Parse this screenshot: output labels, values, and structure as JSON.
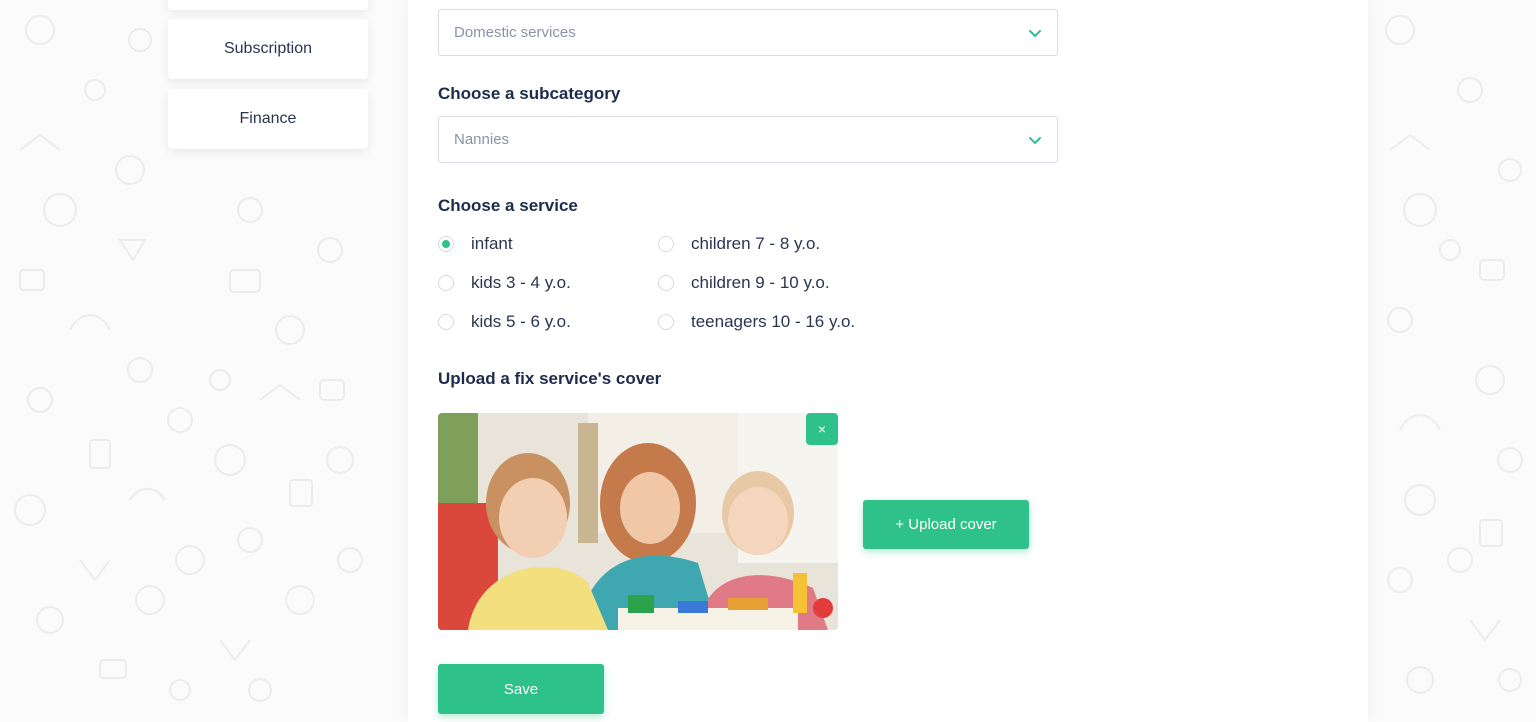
{
  "sidebar": {
    "items": [
      {
        "label": ""
      },
      {
        "label": "Subscription"
      },
      {
        "label": "Finance"
      }
    ]
  },
  "form": {
    "category": {
      "value": "Domestic services",
      "icon": "chevron-down-icon"
    },
    "subcategory": {
      "label": "Choose a subcategory",
      "value": "Nannies",
      "icon": "chevron-down-icon"
    },
    "service": {
      "label": "Choose a service",
      "options": [
        {
          "label": "infant",
          "checked": true
        },
        {
          "label": "kids 3 - 4 y.o.",
          "checked": false
        },
        {
          "label": "kids 5 - 6 y.o.",
          "checked": false
        },
        {
          "label": "children 7 - 8 y.o.",
          "checked": false
        },
        {
          "label": "children 9 - 10 y.o.",
          "checked": false
        },
        {
          "label": "teenagers 10 - 16 y.o.",
          "checked": false
        }
      ]
    },
    "cover": {
      "label": "Upload a fix service's cover",
      "remove_label": "×",
      "upload_label": "+ Upload cover"
    },
    "save_label": "Save"
  },
  "colors": {
    "accent": "#2ec18a",
    "heading": "#1d2b4c",
    "text": "#2a3550",
    "placeholder": "#8a93a3",
    "border": "#d9dde3"
  }
}
